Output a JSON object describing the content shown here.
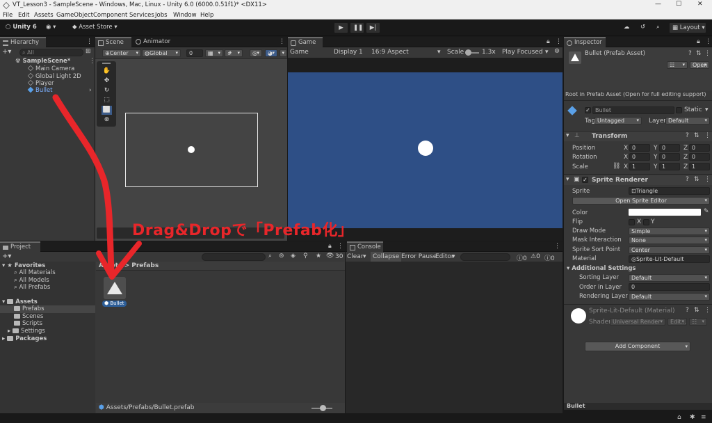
{
  "window": {
    "title": "VT_Lesson3 - SampleScene - Windows, Mac, Linux - Unity 6.0 (6000.0.51f1)* <DX11>",
    "min": "—",
    "max": "☐",
    "close": "✕"
  },
  "menu": [
    "File",
    "Edit",
    "Assets",
    "GameObject",
    "Component",
    "Services",
    "Jobs",
    "Window",
    "Help"
  ],
  "toolbar": {
    "account": "Unity 6",
    "asset_store": "Asset Store",
    "layout": "Layout"
  },
  "hierarchy": {
    "tab": "Hierarchy",
    "search": "All",
    "scene": "SampleScene*",
    "items": [
      "Main Camera",
      "Global Light 2D",
      "Player",
      "Bullet"
    ]
  },
  "scene": {
    "tab": "Scene",
    "animator_tab": "Animator",
    "pivot": "Center",
    "space": "Global",
    "snap": "0"
  },
  "game": {
    "tab": "Game",
    "mode": "Game",
    "display": "Display 1",
    "aspect": "16:9 Aspect",
    "scale_label": "Scale",
    "scale_value": "1.3x",
    "play_mode": "Play Focused",
    "bg": "#2e4f86"
  },
  "annotation": {
    "text": "Drag&Dropで「Prefab化」",
    "color": "#e8262a"
  },
  "project": {
    "tab": "Project",
    "count": "30",
    "breadcrumb": "Assets > Prefabs",
    "asset_name": "Bullet",
    "path": "Assets/Prefabs/Bullet.prefab",
    "favorites": {
      "label": "Favorites",
      "items": [
        "All Materials",
        "All Models",
        "All Prefabs"
      ]
    },
    "assets": {
      "label": "Assets",
      "items": [
        "Prefabs",
        "Scenes",
        "Scripts",
        "Settings"
      ]
    },
    "packages": "Packages"
  },
  "console": {
    "tab": "Console",
    "clear": "Clear",
    "collapse": "Collapse",
    "error_pause": "Error Pause",
    "editor": "Editor",
    "c1": "0",
    "c2": "0",
    "c3": "0"
  },
  "inspector": {
    "tab": "Inspector",
    "asset_title": "Bullet (Prefab Asset)",
    "open": "Open",
    "root_note": "Root in Prefab Asset (Open for full editing support)",
    "name": "Bullet",
    "static": "Static",
    "tag_label": "Tag",
    "tag": "Untagged",
    "layer_label": "Layer",
    "layer": "Default",
    "transform": {
      "title": "Transform",
      "rows": [
        {
          "label": "Position",
          "x": "0",
          "y": "0",
          "z": "0"
        },
        {
          "label": "Rotation",
          "x": "0",
          "y": "0",
          "z": "0"
        },
        {
          "label": "Scale",
          "x": "1",
          "y": "1",
          "z": "1"
        }
      ]
    },
    "sprite_renderer": {
      "title": "Sprite Renderer",
      "sprite_label": "Sprite",
      "sprite": "Triangle",
      "open_editor": "Open Sprite Editor",
      "color_label": "Color",
      "flip_label": "Flip",
      "flip_x": "X",
      "flip_y": "Y",
      "draw_mode_label": "Draw Mode",
      "draw_mode": "Simple",
      "mask_label": "Mask Interaction",
      "mask": "None",
      "sort_point_label": "Sprite Sort Point",
      "sort_point": "Center",
      "material_label": "Material",
      "material": "Sprite-Lit-Default",
      "additional": "Additional Settings",
      "sorting_layer_label": "Sorting Layer",
      "sorting_layer": "Default",
      "order_label": "Order in Layer",
      "order": "0",
      "rendering_layer_label": "Rendering Layer M",
      "rendering_layer": "Default"
    },
    "material": {
      "title": "Sprite-Lit-Default (Material)",
      "shader_label": "Shader",
      "shader": "Universal Render",
      "edit": "Edit..."
    },
    "add_component": "Add Component",
    "footer": "Bullet"
  }
}
